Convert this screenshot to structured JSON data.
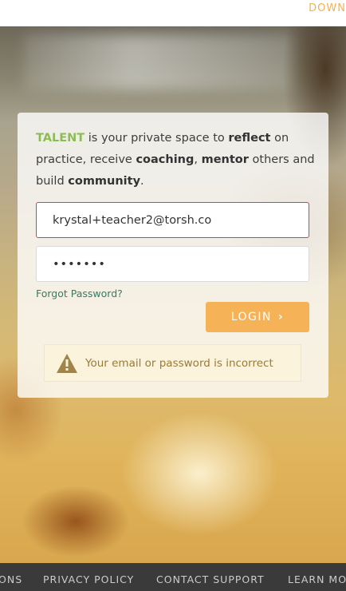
{
  "topbar": {
    "down_label": "DOWN"
  },
  "intro": {
    "brand": "TALENT",
    "text_1": " is your private space to ",
    "reflect": "reflect",
    "text_2": " on practice, receive ",
    "coaching": "coaching",
    "comma": ", ",
    "mentor": "mentor",
    "text_3": " others and build ",
    "community": "community",
    "period": "."
  },
  "form": {
    "email_value": "krystal+teacher2@torsh.co",
    "password_value": "•••••••",
    "forgot_label": "Forgot Password?",
    "login_label": "LOGIN"
  },
  "alert": {
    "message": "Your email or password is incorrect",
    "icon": "warning-icon"
  },
  "footer": {
    "links": [
      "ONS",
      "PRIVACY POLICY",
      "CONTACT SUPPORT",
      "LEARN MO"
    ]
  },
  "colors": {
    "accent": "#f5b257",
    "brand_green": "#8dbb55",
    "error_border": "#d0454a",
    "footer_bg": "#3a3a3a"
  }
}
